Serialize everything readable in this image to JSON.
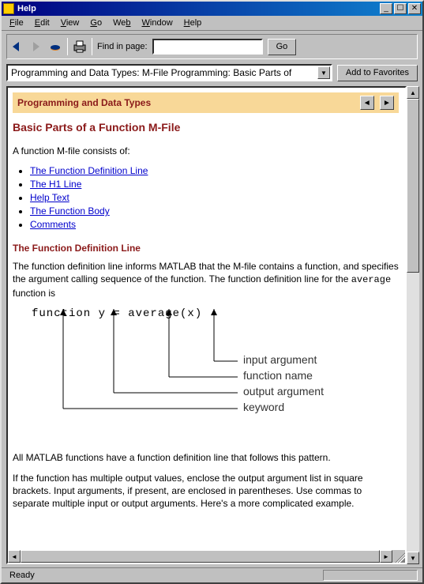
{
  "window": {
    "title": "Help"
  },
  "menubar": {
    "items": [
      "File",
      "Edit",
      "View",
      "Go",
      "Web",
      "Window",
      "Help"
    ]
  },
  "toolbar": {
    "find_label": "Find in page:",
    "go_label": "Go"
  },
  "address": {
    "path": "Programming and Data Types: M-File Programming: Basic Parts of",
    "add_fav": "Add to Favorites"
  },
  "content": {
    "section_header": "Programming and Data Types",
    "page_title": "Basic Parts of a Function M-File",
    "intro": "A function M-file consists of:",
    "links": [
      "The Function Definition Line",
      "The H1 Line",
      "Help Text",
      "The Function Body",
      "Comments"
    ],
    "subhead1": "The Function Definition Line",
    "para1_a": "The function definition line informs MATLAB that the M-file contains a function, and specifies the argument calling sequence of the function. The function definition line for the ",
    "para1_code": "average",
    "para1_b": " function is",
    "code_line": "function y = average(x)",
    "anno_input": "input argument",
    "anno_fname": "function name",
    "anno_output": "output argument",
    "anno_keyword": "keyword",
    "para2": "All MATLAB functions have a function definition line that follows this pattern.",
    "para3": "If the function has multiple output values, enclose the output argument list in square brackets. Input arguments, if present, are enclosed in parentheses. Use commas to separate multiple input or output arguments. Here's a more complicated example."
  },
  "status": {
    "text": "Ready"
  }
}
